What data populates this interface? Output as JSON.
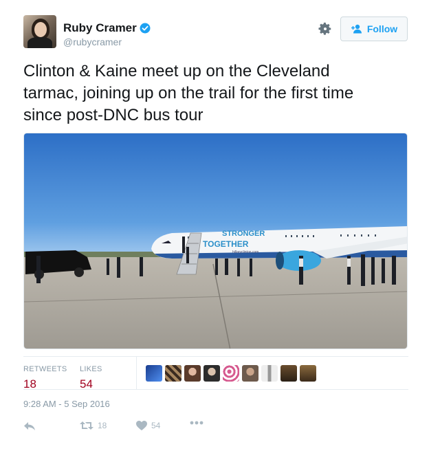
{
  "header": {
    "display_name": "Ruby Cramer",
    "handle": "@rubycramer",
    "verified": true,
    "follow_label": "Follow"
  },
  "tweet": {
    "text_lines": [
      "Clinton & Kaine meet up on the Cleveland",
      "tarmac, joining up on the trail for the first time",
      "since post-DNC bus tour"
    ]
  },
  "media": {
    "plane_livery_line1": "STRONGER",
    "plane_livery_line2": "TOGETHER",
    "plane_livery_url": "hillaryclinton.com"
  },
  "stats": {
    "retweets_label": "RETWEETS",
    "retweets_value": "18",
    "likes_label": "LIKES",
    "likes_value": "54",
    "liker_count": 9
  },
  "timestamp": "9:28 AM - 5 Sep 2016",
  "actions": {
    "retweet_count": "18",
    "like_count": "54"
  },
  "colors": {
    "stat_value": "#a0001e",
    "follow": "#1da1f2",
    "muted": "#8899a6"
  },
  "icons": [
    "verified-badge-icon",
    "gear-icon",
    "follow-user-icon",
    "reply-icon",
    "retweet-icon",
    "heart-icon",
    "more-icon"
  ]
}
